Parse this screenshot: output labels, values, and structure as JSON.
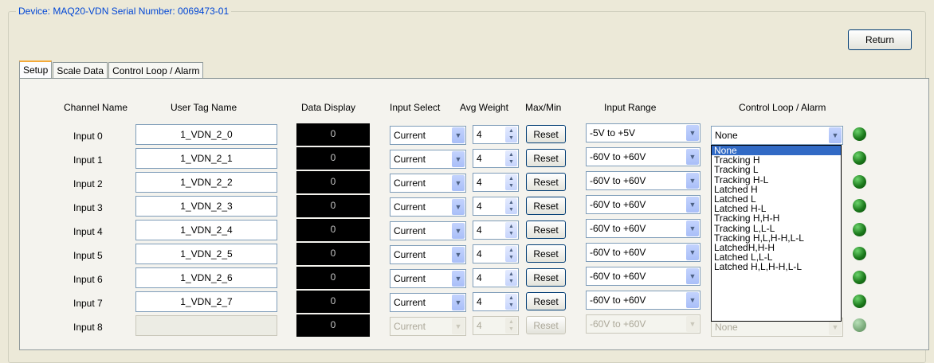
{
  "device": {
    "title": "Device: MAQ20-VDN   Serial Number: 0069473-01"
  },
  "return_label": "Return",
  "tabs": [
    {
      "label": "Setup",
      "active": true
    },
    {
      "label": "Scale Data",
      "active": false
    },
    {
      "label": "Control Loop / Alarm",
      "active": false
    }
  ],
  "headers": {
    "channel_name": "Channel Name",
    "user_tag": "User Tag Name",
    "data_display": "Data Display",
    "input_select": "Input Select",
    "avg_weight": "Avg Weight",
    "max_min": "Max/Min",
    "input_range": "Input Range",
    "control_loop": "Control Loop / Alarm"
  },
  "rows": [
    {
      "name": "Input 0",
      "tag": "1_VDN_2_0",
      "data": "0",
      "input_select": "Current",
      "avg_weight": "4",
      "reset": "Reset",
      "range": "-5V to +5V",
      "control": "None",
      "enabled": true
    },
    {
      "name": "Input 1",
      "tag": "1_VDN_2_1",
      "data": "0",
      "input_select": "Current",
      "avg_weight": "4",
      "reset": "Reset",
      "range": "-60V to +60V",
      "control": "",
      "enabled": true
    },
    {
      "name": "Input 2",
      "tag": "1_VDN_2_2",
      "data": "0",
      "input_select": "Current",
      "avg_weight": "4",
      "reset": "Reset",
      "range": "-60V to +60V",
      "control": "",
      "enabled": true
    },
    {
      "name": "Input 3",
      "tag": "1_VDN_2_3",
      "data": "0",
      "input_select": "Current",
      "avg_weight": "4",
      "reset": "Reset",
      "range": "-60V to +60V",
      "control": "",
      "enabled": true
    },
    {
      "name": "Input 4",
      "tag": "1_VDN_2_4",
      "data": "0",
      "input_select": "Current",
      "avg_weight": "4",
      "reset": "Reset",
      "range": "-60V to +60V",
      "control": "",
      "enabled": true
    },
    {
      "name": "Input 5",
      "tag": "1_VDN_2_5",
      "data": "0",
      "input_select": "Current",
      "avg_weight": "4",
      "reset": "Reset",
      "range": "-60V to +60V",
      "control": "",
      "enabled": true
    },
    {
      "name": "Input 6",
      "tag": "1_VDN_2_6",
      "data": "0",
      "input_select": "Current",
      "avg_weight": "4",
      "reset": "Reset",
      "range": "-60V to +60V",
      "control": "",
      "enabled": true
    },
    {
      "name": "Input 7",
      "tag": "1_VDN_2_7",
      "data": "0",
      "input_select": "Current",
      "avg_weight": "4",
      "reset": "Reset",
      "range": "-60V to +60V",
      "control": "",
      "enabled": true
    },
    {
      "name": "Input 8",
      "tag": "",
      "data": "0",
      "input_select": "Current",
      "avg_weight": "4",
      "reset": "Reset",
      "range": "-60V to +60V",
      "control": "None",
      "enabled": false
    }
  ],
  "dropdown_options": [
    "None",
    "Tracking H",
    "Tracking L",
    "Tracking H-L",
    "Latched H",
    "Latched L",
    "Latched H-L",
    "Tracking H,H-H",
    "Tracking L,L-L",
    "Tracking H,L,H-H,L-L",
    "LatchedH,H-H",
    "Latched L,L-L",
    "Latched H,L,H-H,L-L"
  ],
  "dropdown_selected": "None",
  "colors": {
    "led_on": "#1c7a1c",
    "title": "#0046d5",
    "selection": "#316ac5"
  }
}
